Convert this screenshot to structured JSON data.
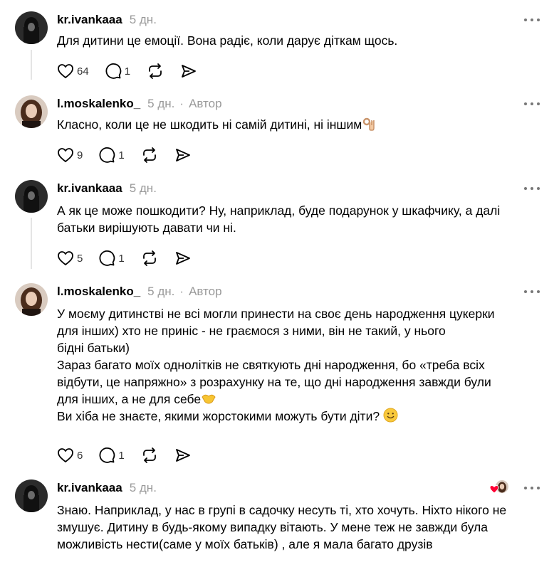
{
  "comments": [
    {
      "username": "kr.ivankaaa",
      "time": "5 дн.",
      "author_badge": "",
      "lines": [
        "Для дитини це емоції. Вона радіє, коли дарує діткам щось."
      ],
      "likes": "64",
      "replies": "1",
      "avatar": "dark-hair-avatar"
    },
    {
      "username": "l.moskalenko_",
      "time": "5 дн.",
      "author_badge": "Автор",
      "lines": [
        "Класно, коли це не шкодить ні самій дитині, ні іншим"
      ],
      "trailing_emoji": "ok-hand-emoji",
      "likes": "9",
      "replies": "1",
      "avatar": "portrait-avatar"
    },
    {
      "username": "kr.ivankaaa",
      "time": "5 дн.",
      "author_badge": "",
      "lines": [
        "А як це може пошкодити? Ну, наприклад, буде подарунок у шкафчику, а далі",
        "батьки вирішують давати чи ні."
      ],
      "likes": "5",
      "replies": "1",
      "avatar": "dark-hair-avatar"
    },
    {
      "username": "l.moskalenko_",
      "time": "5 дн.",
      "author_badge": "Автор",
      "lines": [
        "У моєму дитинстві не всі могли принести на своє день народження цукерки",
        "для інших) хто не приніс - не граємося з ними, він не такий, у нього",
        "бідні батьки)",
        "Зараз багато моїх однолітків не святкують дні народження, бо «треба всіх",
        "відбути, це напряжно» з розрахунку на те, що дні народження завжди були",
        "для інших, а не для себе",
        "Ви хіба не знаєте, якими жорстокими можуть бути діти?"
      ],
      "likes": "6",
      "replies": "1",
      "avatar": "portrait-avatar"
    },
    {
      "username": "kr.ivankaaa",
      "time": "5 дн.",
      "author_badge": "",
      "lines": [
        "Знаю. Наприклад, у нас в групі в садочку несуть ті, хто хочуть. Ніхто нікого не",
        "змушує. Дитину в будь-якому випадку вітають. У мене теж не завжди була",
        "можливість нести(саме у моїх батьків) , але я мала багато друзів"
      ],
      "liked_by_author": "heart-badge",
      "avatar": "dark-hair-avatar"
    }
  ],
  "icons": {
    "like": "heart-outline-icon",
    "reply": "speech-bubble-icon",
    "repost": "repost-icon",
    "share": "send-icon",
    "more": "more-dots-icon"
  },
  "colors": {
    "meta": "#999999",
    "icon": "#000000",
    "heart": "#ff0034"
  }
}
